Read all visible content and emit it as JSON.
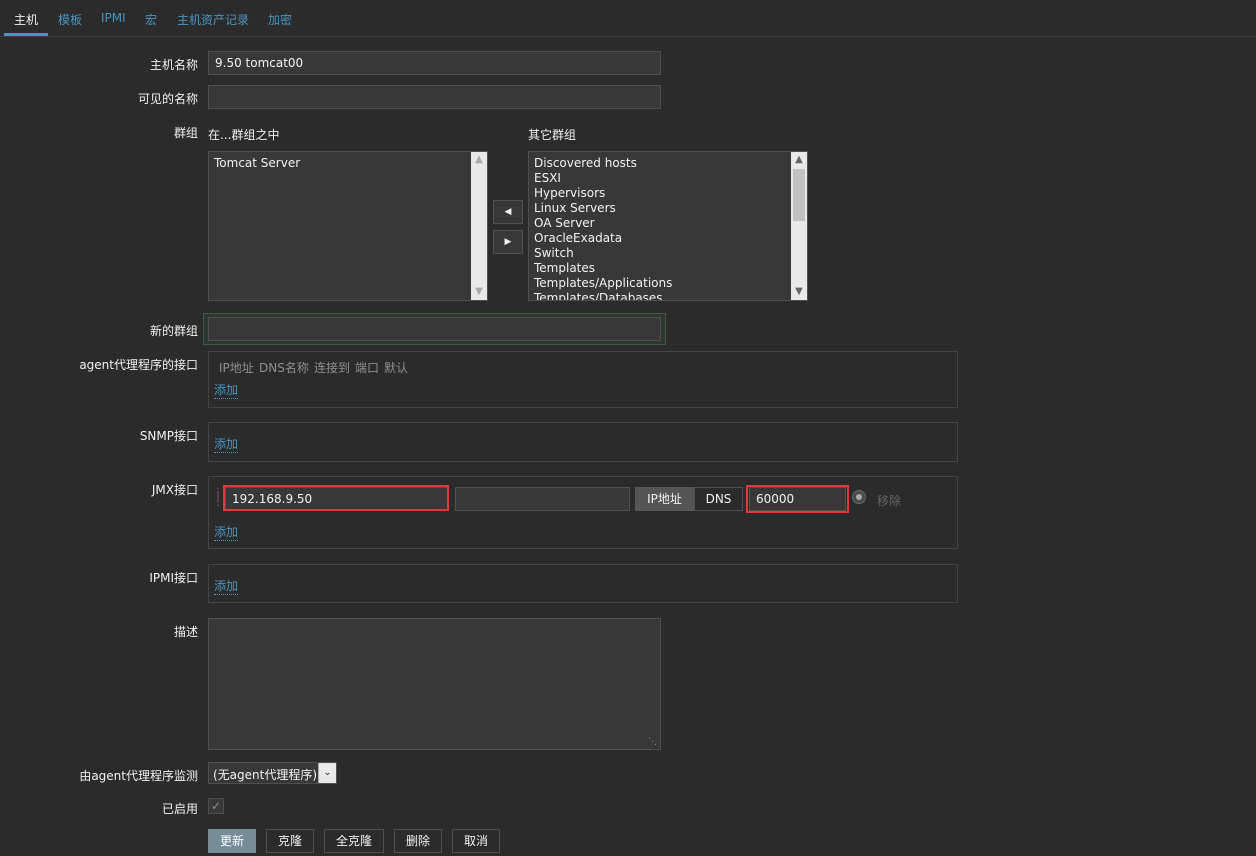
{
  "tabs": [
    "主机",
    "模板",
    "IPMI",
    "宏",
    "主机资产记录",
    "加密"
  ],
  "form": {
    "hostname_label": "主机名称",
    "hostname_value": "9.50 tomcat00",
    "visible_name_label": "可见的名称",
    "visible_name_value": "",
    "groups_label": "群组",
    "in_groups_header": "在...群组之中",
    "other_groups_header": "其它群组",
    "in_groups": [
      "Tomcat Server"
    ],
    "other_groups": [
      "Discovered hosts",
      "ESXI",
      "Hypervisors",
      "Linux Servers",
      "OA Server",
      "OracleExadata",
      "Switch",
      "Templates",
      "Templates/Applications",
      "Templates/Databases"
    ],
    "move_left_icon": "triangle-left",
    "move_right_icon": "triangle-right",
    "new_group_label": "新的群组",
    "new_group_value": "",
    "agent_label": "agent代理程序的接口",
    "agent_headers": [
      "IP地址",
      "DNS名称",
      "连接到",
      "端口",
      "默认"
    ],
    "snmp_label": "SNMP接口",
    "jmx_label": "JMX接口",
    "jmx_ip": "192.168.9.50",
    "jmx_dns": "",
    "jmx_connect_ip": "IP地址",
    "jmx_connect_dns": "DNS",
    "jmx_port": "60000",
    "remove_label": "移除",
    "ipmi_label": "IPMI接口",
    "add_link": "添加",
    "description_label": "描述",
    "description_value": "",
    "proxy_label": "由agent代理程序监测",
    "proxy_value": "(无agent代理程序)",
    "enabled_label": "已启用",
    "enabled": true
  },
  "buttons": {
    "update": "更新",
    "clone": "克隆",
    "full_clone": "全克隆",
    "delete": "删除",
    "cancel": "取消"
  },
  "colors": {
    "background": "#2b2b2b",
    "link": "#4796c4",
    "highlight": "#e03a3a",
    "primary_button": "#768d99"
  }
}
